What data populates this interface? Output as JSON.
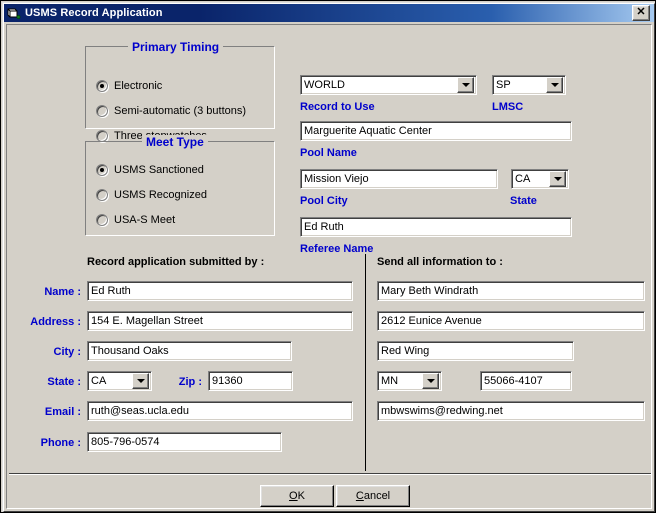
{
  "window": {
    "title": "USMS Record Application",
    "icon": "vb-form-icon",
    "close_label": "✕",
    "close_icon": "close-icon"
  },
  "primary_timing": {
    "legend": "Primary Timing",
    "options": [
      {
        "label": "Electronic",
        "checked": true
      },
      {
        "label": "Semi-automatic (3 buttons)",
        "checked": false
      },
      {
        "label": "Three stopwatches",
        "checked": false
      }
    ]
  },
  "meet_type": {
    "legend": "Meet Type",
    "options": [
      {
        "label": "USMS Sanctioned",
        "checked": true
      },
      {
        "label": "USMS Recognized",
        "checked": false
      },
      {
        "label": "USA-S Meet",
        "checked": false
      }
    ]
  },
  "meet_info": {
    "record_to_use": {
      "label": "Record to Use",
      "value": "WORLD"
    },
    "lmsc": {
      "label": "LMSC",
      "value": "SP"
    },
    "pool_name": {
      "label": "Pool Name",
      "value": "Marguerite Aquatic Center"
    },
    "pool_city": {
      "label": "Pool City",
      "value": "Mission Viejo"
    },
    "pool_state": {
      "label": "State",
      "value": "CA"
    },
    "referee_name": {
      "label": "Referee Name",
      "value": "Ed Ruth"
    }
  },
  "submitter": {
    "heading": "Record application submitted by :",
    "name": {
      "label": "Name :",
      "value": "Ed Ruth"
    },
    "address": {
      "label": "Address :",
      "value": "154 E. Magellan Street"
    },
    "city": {
      "label": "City :",
      "value": "Thousand Oaks"
    },
    "state": {
      "label": "State :",
      "value": "CA"
    },
    "zip": {
      "label": "Zip :",
      "value": "91360"
    },
    "email": {
      "label": "Email :",
      "value": "ruth@seas.ucla.edu"
    },
    "phone": {
      "label": "Phone :",
      "value": "805-796-0574"
    }
  },
  "recipient": {
    "heading": "Send all information to :",
    "name": "Mary Beth Windrath",
    "address": "2612 Eunice Avenue",
    "city": "Red Wing",
    "state": "MN",
    "zip": "55066-4107",
    "email": "mbwswims@redwing.net"
  },
  "buttons": {
    "ok": {
      "pre": "",
      "mnem": "O",
      "post": "K"
    },
    "cancel": {
      "pre": "",
      "mnem": "C",
      "post": "ancel"
    }
  },
  "colors": {
    "titlebar_start": "#0a246a",
    "titlebar_end": "#a6caf0",
    "face": "#d4d0c8",
    "label_blue": "#0000cc",
    "field_bg": "#ffffff"
  }
}
